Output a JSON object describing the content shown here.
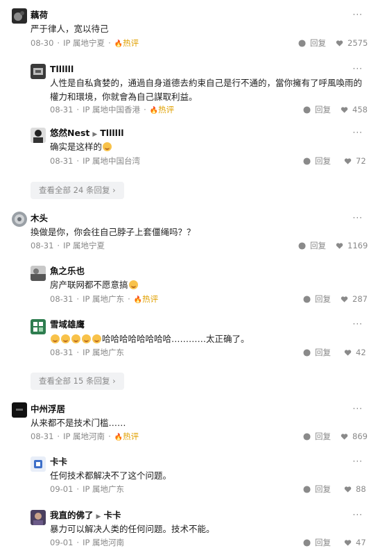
{
  "threads": [
    {
      "author": "藕荷",
      "text": "严于律人，宽以待己",
      "date": "08-30",
      "ip": "IP 属地宁夏",
      "hot": "热评",
      "reply_label": "回复",
      "likes": "2575",
      "replies": [
        {
          "author": "Tllllll",
          "text": "人性是自私貪婪的，通過自身道德去約束自己是行不通的，當你擁有了呼風喚雨的權力和環境，你就會為自己謀取利益。",
          "date": "08-31",
          "ip": "IP 属地中国香港",
          "hot": "热评",
          "reply_label": "回复",
          "likes": "458"
        },
        {
          "author": "悠然Nest",
          "reply_to": "Tllllll",
          "text": "确实是这样的",
          "date": "08-31",
          "ip": "IP 属地中国台湾",
          "reply_label": "回复",
          "likes": "72"
        }
      ],
      "expand_label": "查看全部 24 条回复"
    },
    {
      "author": "木头",
      "text": "換做是你，你会往自己脖子上套僵绳吗？？",
      "date": "08-31",
      "ip": "IP 属地宁夏",
      "reply_label": "回复",
      "likes": "1169",
      "replies": [
        {
          "author": "魚之乐也",
          "text": "房产联网都不愿意搞",
          "date": "08-31",
          "ip": "IP 属地广东",
          "hot": "热评",
          "reply_label": "回复",
          "likes": "287"
        },
        {
          "author": "雪域雄鹰",
          "text": "哈哈哈哈哈哈哈哈…………太正确了。",
          "date": "08-31",
          "ip": "IP 属地广东",
          "reply_label": "回复",
          "likes": "42"
        }
      ],
      "expand_label": "查看全部 15 条回复"
    },
    {
      "author": "中州浮居",
      "text": "从来都不是技术门槛……",
      "date": "08-31",
      "ip": "IP 属地河南",
      "hot": "热评",
      "reply_label": "回复",
      "likes": "869",
      "replies": [
        {
          "author": "卡卡",
          "text": "任何技术都解决不了这个问题。",
          "date": "09-01",
          "ip": "IP 属地广东",
          "reply_label": "回复",
          "likes": "88"
        },
        {
          "author": "我直的佛了",
          "reply_to": "卡卡",
          "text": "暴力可以解决人类的任何问题。技术不能。",
          "date": "09-01",
          "ip": "IP 属地河南",
          "reply_label": "回复",
          "likes": "47"
        }
      ]
    }
  ],
  "icons": {
    "comment": "comment-bubble-icon",
    "like": "heart-icon",
    "more": "more-dots-icon",
    "hot": "flame-icon",
    "expand": "chevron-right-icon",
    "reply_arrow": "triangle-right-icon",
    "emoji": "laughing-emoji-icon"
  },
  "colors": {
    "hot": "#e0a000",
    "meta": "#888888",
    "expand_bg": "#f1f2f4"
  }
}
